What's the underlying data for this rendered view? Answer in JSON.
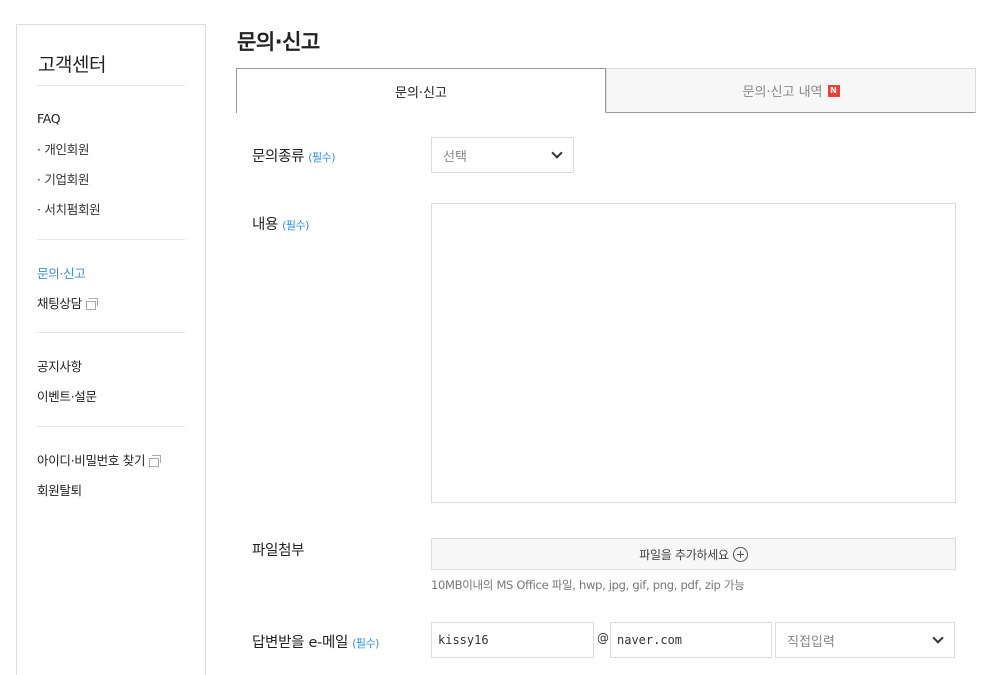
{
  "sidebar": {
    "title": "고객센터",
    "items": [
      {
        "label": "FAQ"
      },
      {
        "label": "· 개인회원"
      },
      {
        "label": "· 기업회원"
      },
      {
        "label": "· 서치펌회원"
      },
      {
        "label": "문의·신고"
      },
      {
        "label": "채팅상담"
      },
      {
        "label": "공지사항"
      },
      {
        "label": "이벤트·설문"
      },
      {
        "label": "아이디·비밀번호 찾기"
      },
      {
        "label": "회원탈퇴"
      }
    ]
  },
  "page": {
    "title": "문의·신고"
  },
  "tabs": [
    {
      "label": "문의·신고",
      "active": true
    },
    {
      "label": "문의·신고 내역",
      "active": false,
      "badge": "N"
    }
  ],
  "form": {
    "required_mark": "(필수)",
    "inquiry_type": {
      "label": "문의종류",
      "selected": "선택"
    },
    "content": {
      "label": "내용",
      "value": ""
    },
    "attachment": {
      "label": "파일첨부",
      "button_label": "파일을 추가하세요",
      "note": "10MB이내의 MS Office 파일, hwp, jpg, gif, png, pdf, zip 가능"
    },
    "email": {
      "label": "답변받을 e-메일",
      "local_part": "kissy16",
      "at": "@",
      "domain": "naver.com",
      "domain_select": "직접입력"
    }
  },
  "colors": {
    "accent_blue": "#3a8fd8",
    "badge_red": "#e8423a",
    "border": "#dcdcdc"
  }
}
